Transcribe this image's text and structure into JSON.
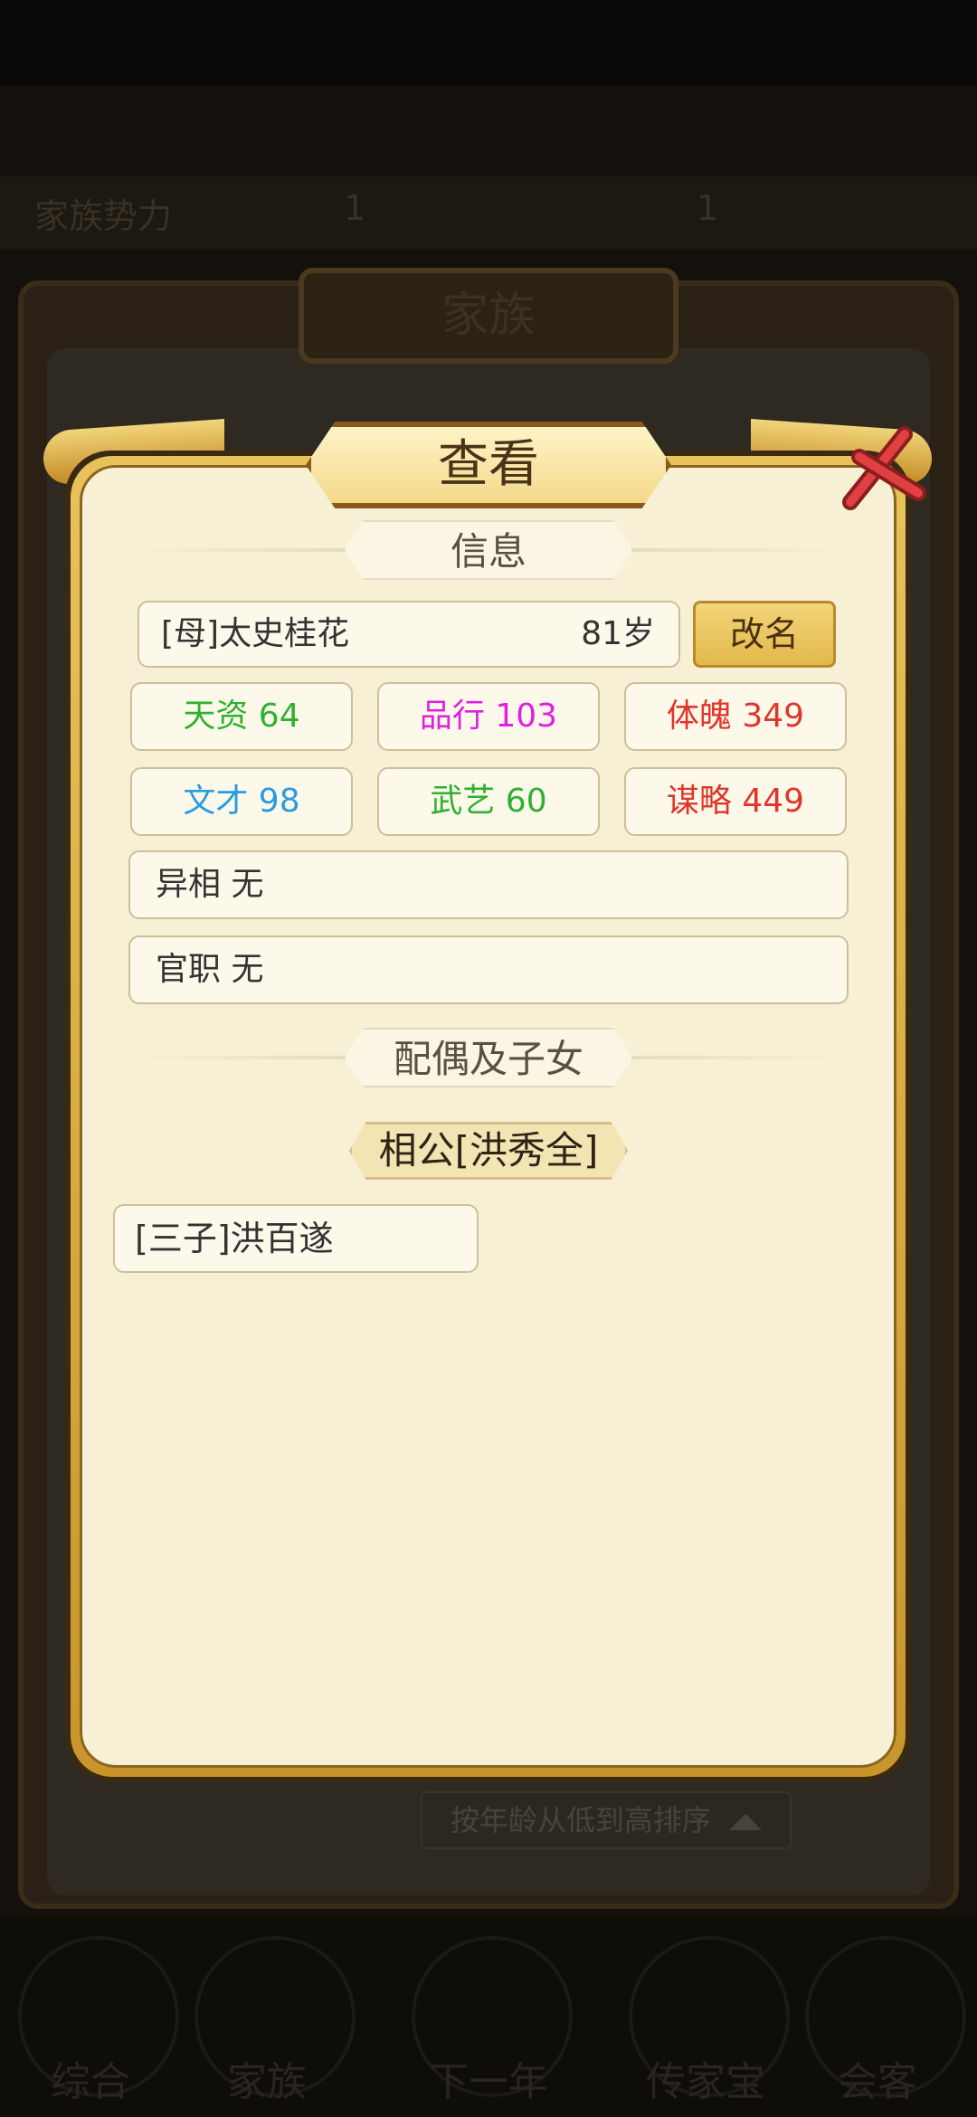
{
  "background": {
    "top_left": "家族势力",
    "top_mid": "1",
    "top_right": "1",
    "title": "家族",
    "sort_label": "按年龄从低到高排序",
    "nav": [
      "综合",
      "家族",
      "下一年",
      "传家宝",
      "会客"
    ]
  },
  "dialog": {
    "title": "查看",
    "info_header": "信息",
    "person": {
      "name": "[母]太史桂花",
      "age": "81岁"
    },
    "rename_label": "改名",
    "stats": [
      {
        "label": "天资 64",
        "color": "#2fb02f"
      },
      {
        "label": "品行 103",
        "color": "#e020e0"
      },
      {
        "label": "体魄 349",
        "color": "#e0352a"
      },
      {
        "label": "文才 98",
        "color": "#2a9be0"
      },
      {
        "label": "武艺 60",
        "color": "#2fb02f"
      },
      {
        "label": "谋略 449",
        "color": "#e0352a"
      }
    ],
    "trait": "异相 无",
    "office": "官职 无",
    "family_header": "配偶及子女",
    "spouse": "相公[洪秀全]",
    "children": [
      "[三子]洪百遂"
    ]
  }
}
